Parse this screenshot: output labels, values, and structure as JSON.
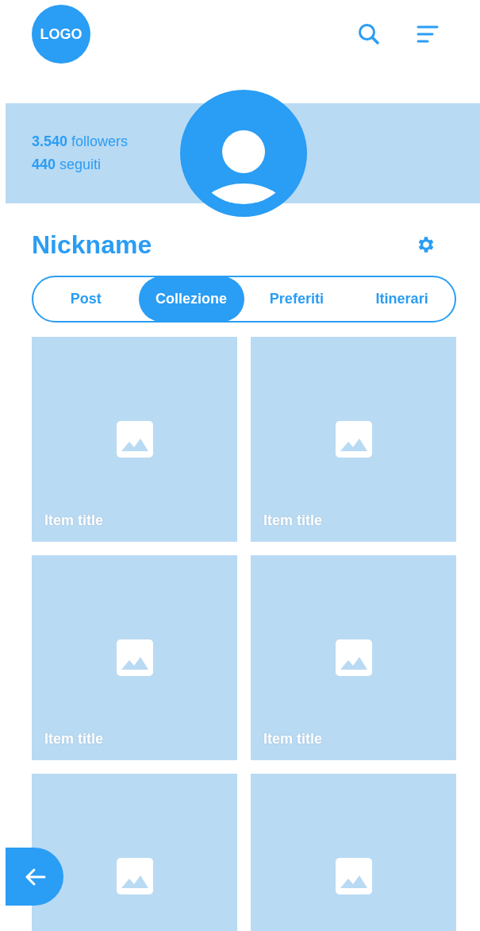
{
  "header": {
    "logo": "LOGO"
  },
  "profile": {
    "followers_count": "3.540",
    "followers_label": "followers",
    "following_count": "440",
    "following_label": "seguiti",
    "nickname": "Nickname"
  },
  "tabs": [
    {
      "label": "Post",
      "selected": false
    },
    {
      "label": "Collezione",
      "selected": true
    },
    {
      "label": "Preferiti",
      "selected": false
    },
    {
      "label": "Itinerari",
      "selected": false
    }
  ],
  "items": [
    {
      "kind": "picture",
      "title": "Item title"
    },
    {
      "kind": "picture",
      "title": "Item title"
    },
    {
      "kind": "picture",
      "title": "Item title"
    },
    {
      "kind": "picture",
      "title": "Item title"
    },
    {
      "kind": "picture"
    },
    {
      "kind": "picture"
    }
  ]
}
